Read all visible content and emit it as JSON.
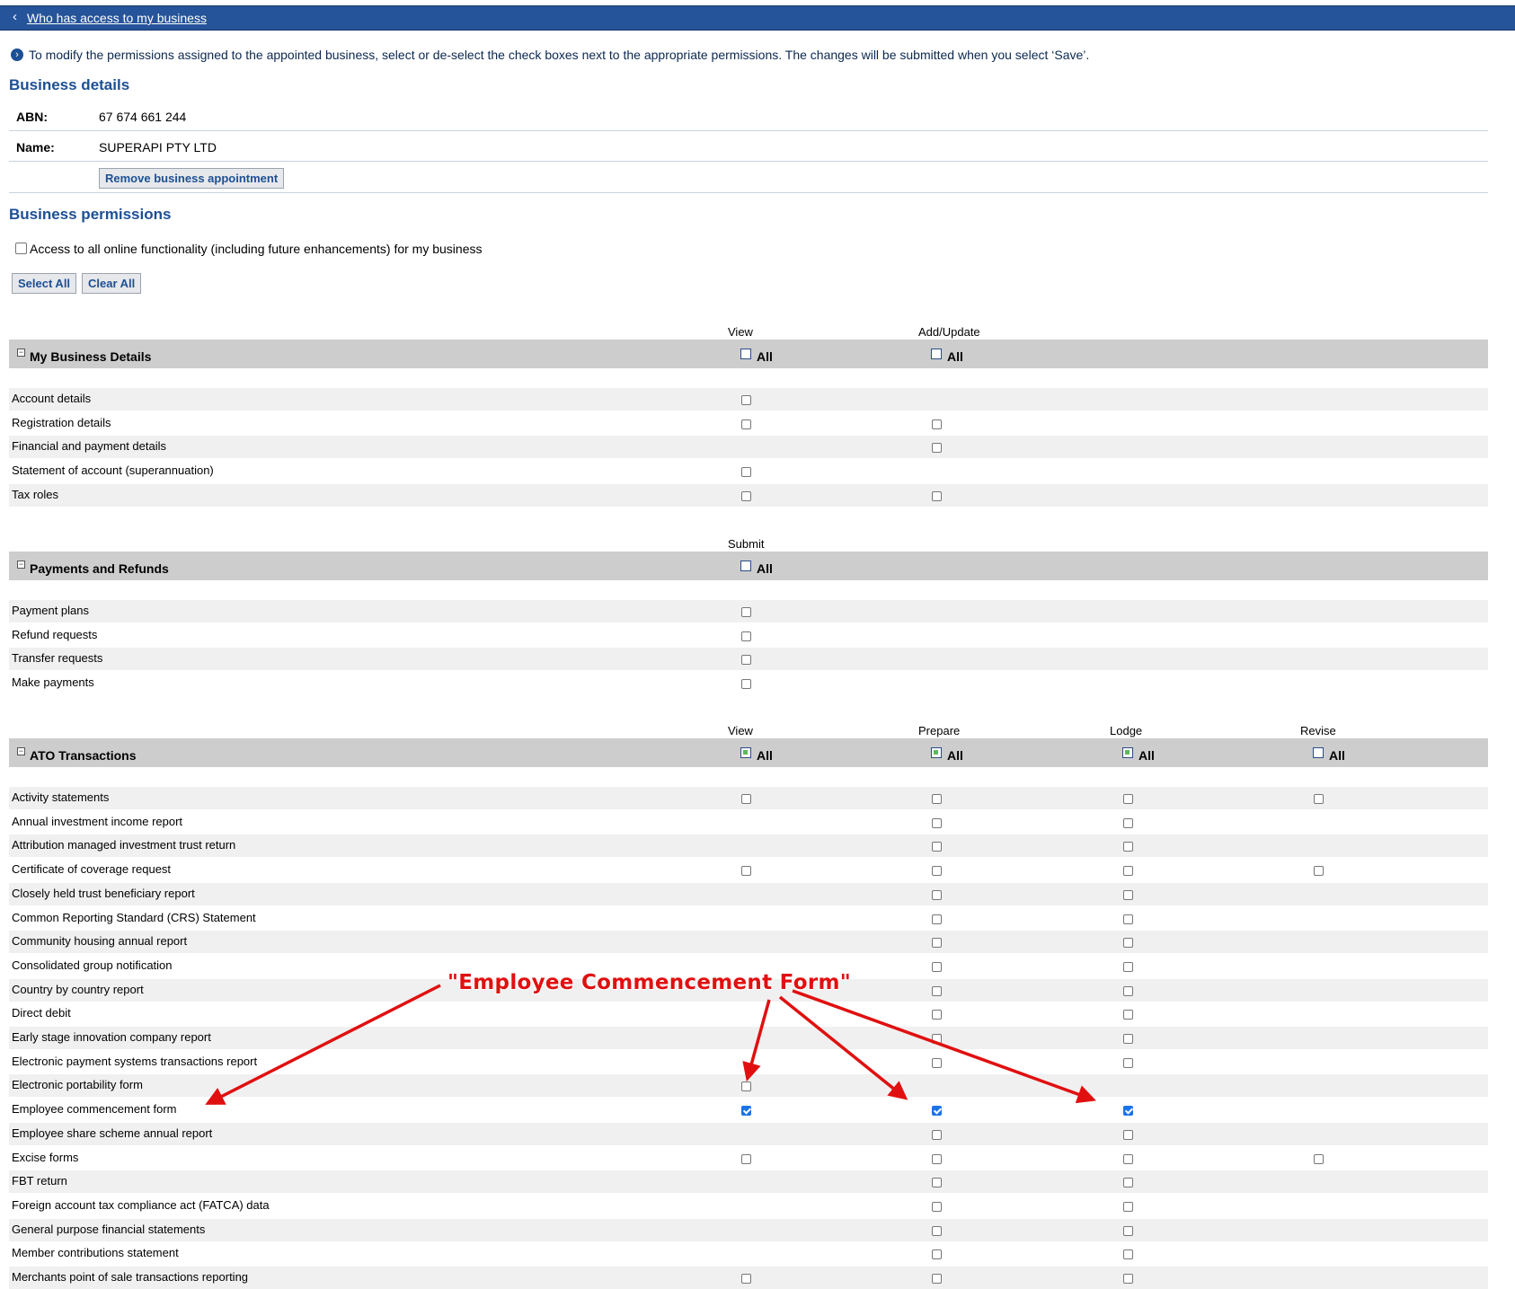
{
  "nav": {
    "back_link": "Who has access to my business"
  },
  "info_text": "To modify the permissions assigned to the appointed business, select or de-select the check boxes next to the appropriate permissions. The changes will be submitted when you select ‘Save’.",
  "business_details": {
    "heading": "Business details",
    "abn_label": "ABN:",
    "abn_value": "67 674 661 244",
    "name_label": "Name:",
    "name_value": "SUPERAPI PTY LTD",
    "remove_button": "Remove business appointment"
  },
  "permissions": {
    "heading": "Business permissions",
    "access_all_label": "Access to all online functionality (including future enhancements) for my business",
    "select_all": "Select All",
    "clear_all": "Clear All"
  },
  "sections": [
    {
      "title": "My Business Details",
      "columns": [
        "View",
        "Add/Update"
      ],
      "all_label": "All",
      "all_states": [
        "empty",
        "empty"
      ],
      "rows": [
        {
          "label": "Account details",
          "cells": [
            "off",
            null
          ]
        },
        {
          "label": "Registration details",
          "cells": [
            "off",
            "off"
          ]
        },
        {
          "label": "Financial and payment details",
          "cells": [
            null,
            "off"
          ]
        },
        {
          "label": "Statement of account (superannuation)",
          "cells": [
            "off",
            null
          ]
        },
        {
          "label": "Tax roles",
          "cells": [
            "off",
            "off"
          ]
        }
      ]
    },
    {
      "title": "Payments and Refunds",
      "columns": [
        "Submit"
      ],
      "all_label": "All",
      "all_states": [
        "empty"
      ],
      "rows": [
        {
          "label": "Payment plans",
          "cells": [
            "off"
          ]
        },
        {
          "label": "Refund requests",
          "cells": [
            "off"
          ]
        },
        {
          "label": "Transfer requests",
          "cells": [
            "off"
          ]
        },
        {
          "label": "Make payments",
          "cells": [
            "off"
          ]
        }
      ]
    },
    {
      "title": "ATO Transactions",
      "columns": [
        "View",
        "Prepare",
        "Lodge",
        "Revise"
      ],
      "all_label": "All",
      "all_states": [
        "partial",
        "partial",
        "partial",
        "empty"
      ],
      "rows": [
        {
          "label": "Activity statements",
          "cells": [
            "off",
            "off",
            "off",
            "off"
          ]
        },
        {
          "label": "Annual investment income report",
          "cells": [
            null,
            "off",
            "off",
            null
          ]
        },
        {
          "label": "Attribution managed investment trust return",
          "cells": [
            null,
            "off",
            "off",
            null
          ]
        },
        {
          "label": "Certificate of coverage request",
          "cells": [
            "off",
            "off",
            "off",
            "off"
          ]
        },
        {
          "label": "Closely held trust beneficiary report",
          "cells": [
            null,
            "off",
            "off",
            null
          ]
        },
        {
          "label": "Common Reporting Standard (CRS) Statement",
          "cells": [
            null,
            "off",
            "off",
            null
          ]
        },
        {
          "label": "Community housing annual report",
          "cells": [
            null,
            "off",
            "off",
            null
          ]
        },
        {
          "label": "Consolidated group notification",
          "cells": [
            null,
            "off",
            "off",
            null
          ]
        },
        {
          "label": "Country by country report",
          "cells": [
            null,
            "off",
            "off",
            null
          ]
        },
        {
          "label": "Direct debit",
          "cells": [
            null,
            "off",
            "off",
            null
          ]
        },
        {
          "label": "Early stage innovation company report",
          "cells": [
            null,
            "off",
            "off",
            null
          ]
        },
        {
          "label": "Electronic payment systems transactions report",
          "cells": [
            null,
            "off",
            "off",
            null
          ]
        },
        {
          "label": "Electronic portability form",
          "cells": [
            "off",
            null,
            null,
            null
          ]
        },
        {
          "label": "Employee commencement form",
          "cells": [
            "on",
            "on",
            "on",
            null
          ]
        },
        {
          "label": "Employee share scheme annual report",
          "cells": [
            null,
            "off",
            "off",
            null
          ]
        },
        {
          "label": "Excise forms",
          "cells": [
            "off",
            "off",
            "off",
            "off"
          ]
        },
        {
          "label": "FBT return",
          "cells": [
            null,
            "off",
            "off",
            null
          ]
        },
        {
          "label": "Foreign account tax compliance act (FATCA) data",
          "cells": [
            null,
            "off",
            "off",
            null
          ]
        },
        {
          "label": "General purpose financial statements",
          "cells": [
            null,
            "off",
            "off",
            null
          ]
        },
        {
          "label": "Member contributions statement",
          "cells": [
            null,
            "off",
            "off",
            null
          ]
        },
        {
          "label": "Merchants point of sale transactions reporting",
          "cells": [
            "off",
            "off",
            "off",
            null
          ]
        }
      ]
    }
  ],
  "annotation": {
    "text": "\"Employee Commencement Form\"",
    "color": "#e01010"
  },
  "colors": {
    "accent": "#26549a",
    "heading": "#1d4f94",
    "section_bg": "#cdcdcd"
  }
}
